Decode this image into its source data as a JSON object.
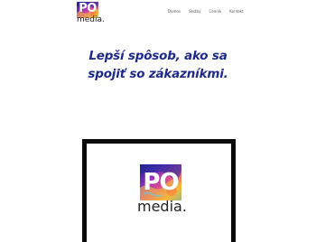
{
  "header": {
    "logo": {
      "mark": "PO",
      "word": "media."
    },
    "nav": [
      {
        "label": "Domov"
      },
      {
        "label": "Služby"
      },
      {
        "label": "Cenník"
      },
      {
        "label": "Kontakt"
      }
    ]
  },
  "hero": {
    "line1": "Lepší spôsob, ako sa",
    "line2": "spojiť so zákazníkmi."
  },
  "showcase": {
    "logo": {
      "mark": "PO",
      "word": "media."
    }
  },
  "colors": {
    "heading": "#1d2a8a",
    "frame": "#0c0c0c",
    "background": "#ffffff"
  },
  "icons": {
    "logo_art": "marbled-paint-art"
  }
}
